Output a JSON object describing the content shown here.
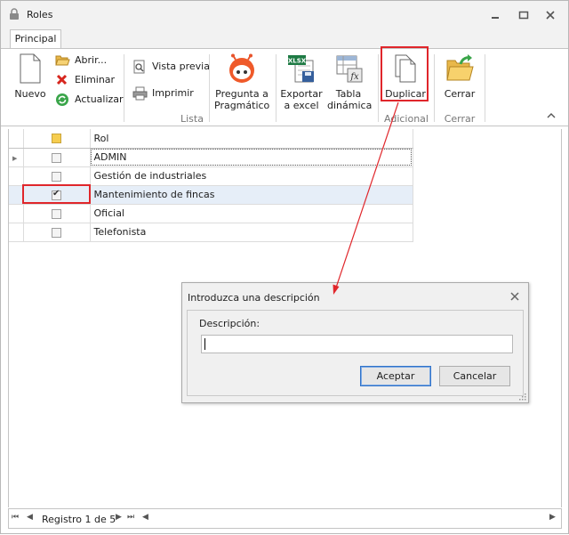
{
  "window": {
    "title": "Roles"
  },
  "ribbon": {
    "tab": "Principal",
    "buttons": {
      "nuevo": "Nuevo",
      "abrir": "Abrir...",
      "eliminar": "Eliminar",
      "actualizar": "Actualizar",
      "vista_previa": "Vista previa",
      "imprimir": "Imprimir",
      "pregunta_l1": "Pregunta a",
      "pregunta_l2": "Pragmático",
      "exportar_l1": "Exportar",
      "exportar_l2": "a excel",
      "tabla_l1": "Tabla",
      "tabla_l2": "dinámica",
      "duplicar": "Duplicar",
      "cerrar": "Cerrar"
    },
    "groups": {
      "lista": "Lista",
      "adicional": "Adicional",
      "cerrar": "Cerrar"
    },
    "icon_texts": {
      "xlsx": "XLSX",
      "fx": "fx"
    }
  },
  "grid": {
    "header": "Rol",
    "rows": [
      {
        "name": "ADMIN",
        "checked": false
      },
      {
        "name": "Gestión de industriales",
        "checked": false
      },
      {
        "name": "Mantenimiento de fincas",
        "checked": true
      },
      {
        "name": "Oficial",
        "checked": false
      },
      {
        "name": "Telefonista",
        "checked": false
      }
    ]
  },
  "navigator": {
    "record_text": "Registro 1 de 5"
  },
  "dialog": {
    "title": "Introduzca una descripción",
    "label": "Descripción:",
    "value": "",
    "ok": "Aceptar",
    "cancel": "Cancelar"
  },
  "colors": {
    "highlight": "#e0262b",
    "accent": "#3173c9",
    "selection": "#e6eef8"
  }
}
